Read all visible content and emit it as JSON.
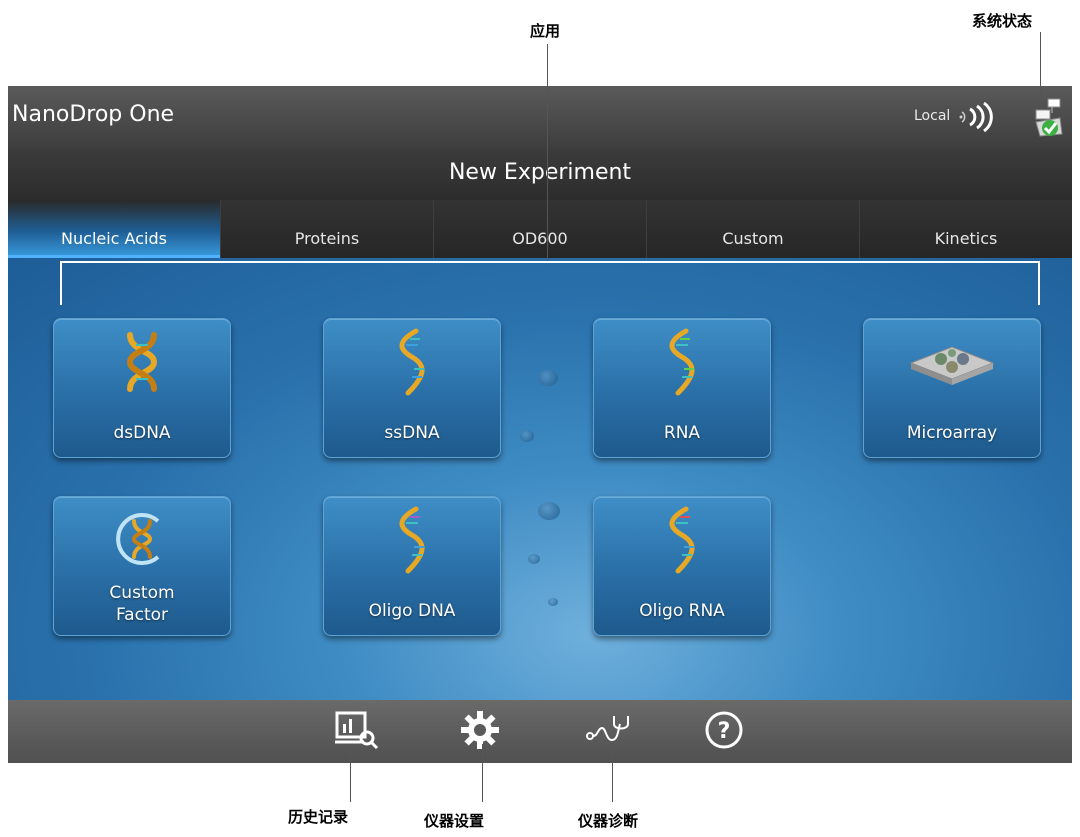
{
  "annotations": {
    "applications": "应用",
    "system_status": "系统状态",
    "history": "历史记录",
    "instrument_settings": "仪器设置",
    "instrument_diagnostics": "仪器诊断"
  },
  "titlebar": {
    "app_title": "NanoDrop One",
    "connection_label": "Local",
    "connection_icon": "wireless-signal-icon",
    "status_icon": "system-status-icon"
  },
  "header": {
    "title": "New Experiment"
  },
  "tabs": [
    {
      "label": "Nucleic Acids",
      "active": true
    },
    {
      "label": "Proteins",
      "active": false
    },
    {
      "label": "OD600",
      "active": false
    },
    {
      "label": "Custom",
      "active": false
    },
    {
      "label": "Kinetics",
      "active": false
    }
  ],
  "apps": [
    {
      "label": "dsDNA",
      "icon": "dna-double-helix-icon"
    },
    {
      "label": "ssDNA",
      "icon": "dna-helix-icon"
    },
    {
      "label": "RNA",
      "icon": "rna-helix-icon"
    },
    {
      "label": "Microarray",
      "icon": "microarray-slide-icon"
    },
    {
      "label": "Custom",
      "label2": "Factor",
      "icon": "custom-factor-icon"
    },
    {
      "label": "Oligo DNA",
      "icon": "oligo-dna-icon"
    },
    {
      "label": "Oligo RNA",
      "icon": "oligo-rna-icon"
    }
  ],
  "bottombar": {
    "history_icon": "history-chart-search-icon",
    "settings_icon": "gear-icon",
    "diagnostics_icon": "stethoscope-icon",
    "help_icon": "help-question-icon"
  },
  "colors": {
    "accent_tab": "#3a9ee0",
    "background_blue": "#2a72ad",
    "titlebar": "#4a4a4a",
    "status_green": "#3cb043"
  }
}
